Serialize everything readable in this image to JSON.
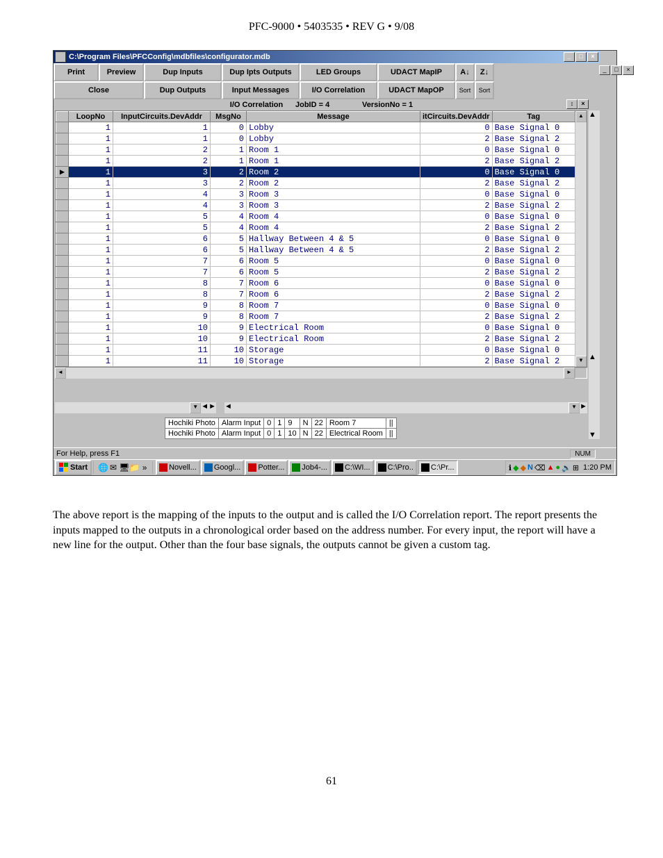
{
  "page": {
    "header": "PFC-9000 • 5403535 • REV G • 9/08",
    "footer": "61",
    "caption": "The above report is the mapping of the inputs to the output and is called the I/O Correlation report. The report presents the inputs mapped to the outputs in a chronological order based on the address number. For every input, the report will have a new line for the output. Other than the four base signals, the outputs cannot be given a custom tag."
  },
  "window": {
    "title": "C:\\Program Files\\PFCConfig\\mdbfiles\\configurator.mdb"
  },
  "toolbar": {
    "row1": [
      "Print",
      "Preview",
      "Dup Inputs",
      "Dup Ipts Outputs",
      "LED Groups",
      "UDACT MapIP"
    ],
    "row2": [
      "Close",
      "Dup Outputs",
      "Input Messages",
      "I/O Correlation",
      "UDACT MapOP"
    ],
    "sort_asc_icon": "A↓",
    "sort_desc_icon": "Z↓",
    "sort_label": "Sort"
  },
  "info": {
    "title": "I/O Correlation",
    "job": "JobID = 4",
    "version": "VersionNo = 1"
  },
  "grid": {
    "cols": [
      "LoopNo",
      "InputCircuits.DevAddr",
      "MsgNo",
      "Message",
      "itCircuits.DevAddr",
      "Tag"
    ],
    "selected_index": 4,
    "rows": [
      {
        "loop": "1",
        "dev": "1",
        "msg": "0",
        "message": "Lobby",
        "it": "0",
        "tag": "Base Signal 0"
      },
      {
        "loop": "1",
        "dev": "1",
        "msg": "0",
        "message": "Lobby",
        "it": "2",
        "tag": "Base Signal 2"
      },
      {
        "loop": "1",
        "dev": "2",
        "msg": "1",
        "message": "Room 1",
        "it": "0",
        "tag": "Base Signal 0"
      },
      {
        "loop": "1",
        "dev": "2",
        "msg": "1",
        "message": "Room 1",
        "it": "2",
        "tag": "Base Signal 2"
      },
      {
        "loop": "1",
        "dev": "3",
        "msg": "2",
        "message": "Room 2",
        "it": "0",
        "tag": "Base Signal 0"
      },
      {
        "loop": "1",
        "dev": "3",
        "msg": "2",
        "message": "Room 2",
        "it": "2",
        "tag": "Base Signal 2"
      },
      {
        "loop": "1",
        "dev": "4",
        "msg": "3",
        "message": "Room 3",
        "it": "0",
        "tag": "Base Signal 0"
      },
      {
        "loop": "1",
        "dev": "4",
        "msg": "3",
        "message": "Room 3",
        "it": "2",
        "tag": "Base Signal 2"
      },
      {
        "loop": "1",
        "dev": "5",
        "msg": "4",
        "message": "Room 4",
        "it": "0",
        "tag": "Base Signal 0"
      },
      {
        "loop": "1",
        "dev": "5",
        "msg": "4",
        "message": "Room 4",
        "it": "2",
        "tag": "Base Signal 2"
      },
      {
        "loop": "1",
        "dev": "6",
        "msg": "5",
        "message": "Hallway        Between 4 & 5",
        "it": "0",
        "tag": "Base Signal 0"
      },
      {
        "loop": "1",
        "dev": "6",
        "msg": "5",
        "message": "Hallway        Between 4 & 5",
        "it": "2",
        "tag": "Base Signal 2"
      },
      {
        "loop": "1",
        "dev": "7",
        "msg": "6",
        "message": "Room 5",
        "it": "0",
        "tag": "Base Signal 0"
      },
      {
        "loop": "1",
        "dev": "7",
        "msg": "6",
        "message": "Room 5",
        "it": "2",
        "tag": "Base Signal 2"
      },
      {
        "loop": "1",
        "dev": "8",
        "msg": "7",
        "message": "Room 6",
        "it": "0",
        "tag": "Base Signal 0"
      },
      {
        "loop": "1",
        "dev": "8",
        "msg": "7",
        "message": "Room 6",
        "it": "2",
        "tag": "Base Signal 2"
      },
      {
        "loop": "1",
        "dev": "9",
        "msg": "8",
        "message": "Room 7",
        "it": "0",
        "tag": "Base Signal 0"
      },
      {
        "loop": "1",
        "dev": "9",
        "msg": "8",
        "message": "Room 7",
        "it": "2",
        "tag": "Base Signal 2"
      },
      {
        "loop": "1",
        "dev": "10",
        "msg": "9",
        "message": "Electrical Room",
        "it": "0",
        "tag": "Base Signal 0"
      },
      {
        "loop": "1",
        "dev": "10",
        "msg": "9",
        "message": "Electrical Room",
        "it": "2",
        "tag": "Base Signal 2"
      },
      {
        "loop": "1",
        "dev": "11",
        "msg": "10",
        "message": "Storage",
        "it": "0",
        "tag": "Base Signal 0"
      },
      {
        "loop": "1",
        "dev": "11",
        "msg": "10",
        "message": "Storage",
        "it": "2",
        "tag": "Base Signal 2"
      }
    ]
  },
  "lower_rows": [
    [
      "Hochiki Photo",
      "Alarm Input",
      "0",
      "1",
      "9",
      "N",
      "22",
      "Room 7",
      "||"
    ],
    [
      "Hochiki Photo",
      "Alarm Input",
      "0",
      "1",
      "10",
      "N",
      "22",
      "Electrical Room",
      "||"
    ]
  ],
  "status": {
    "help": "For Help, press F1",
    "num": "NUM"
  },
  "taskbar": {
    "start": "Start",
    "tasks": [
      {
        "label": "Novell...",
        "color": "#cc0000"
      },
      {
        "label": "Googl...",
        "color": "#0060b0"
      },
      {
        "label": "Potter...",
        "color": "#cc0000"
      },
      {
        "label": "Job4-...",
        "color": "#008000"
      },
      {
        "label": "C:\\WI...",
        "color": "#000"
      },
      {
        "label": "C:\\Pro..",
        "color": "#000"
      },
      {
        "label": "C:\\Pr...",
        "color": "#000",
        "active": true
      }
    ],
    "clock": "1:20 PM"
  }
}
